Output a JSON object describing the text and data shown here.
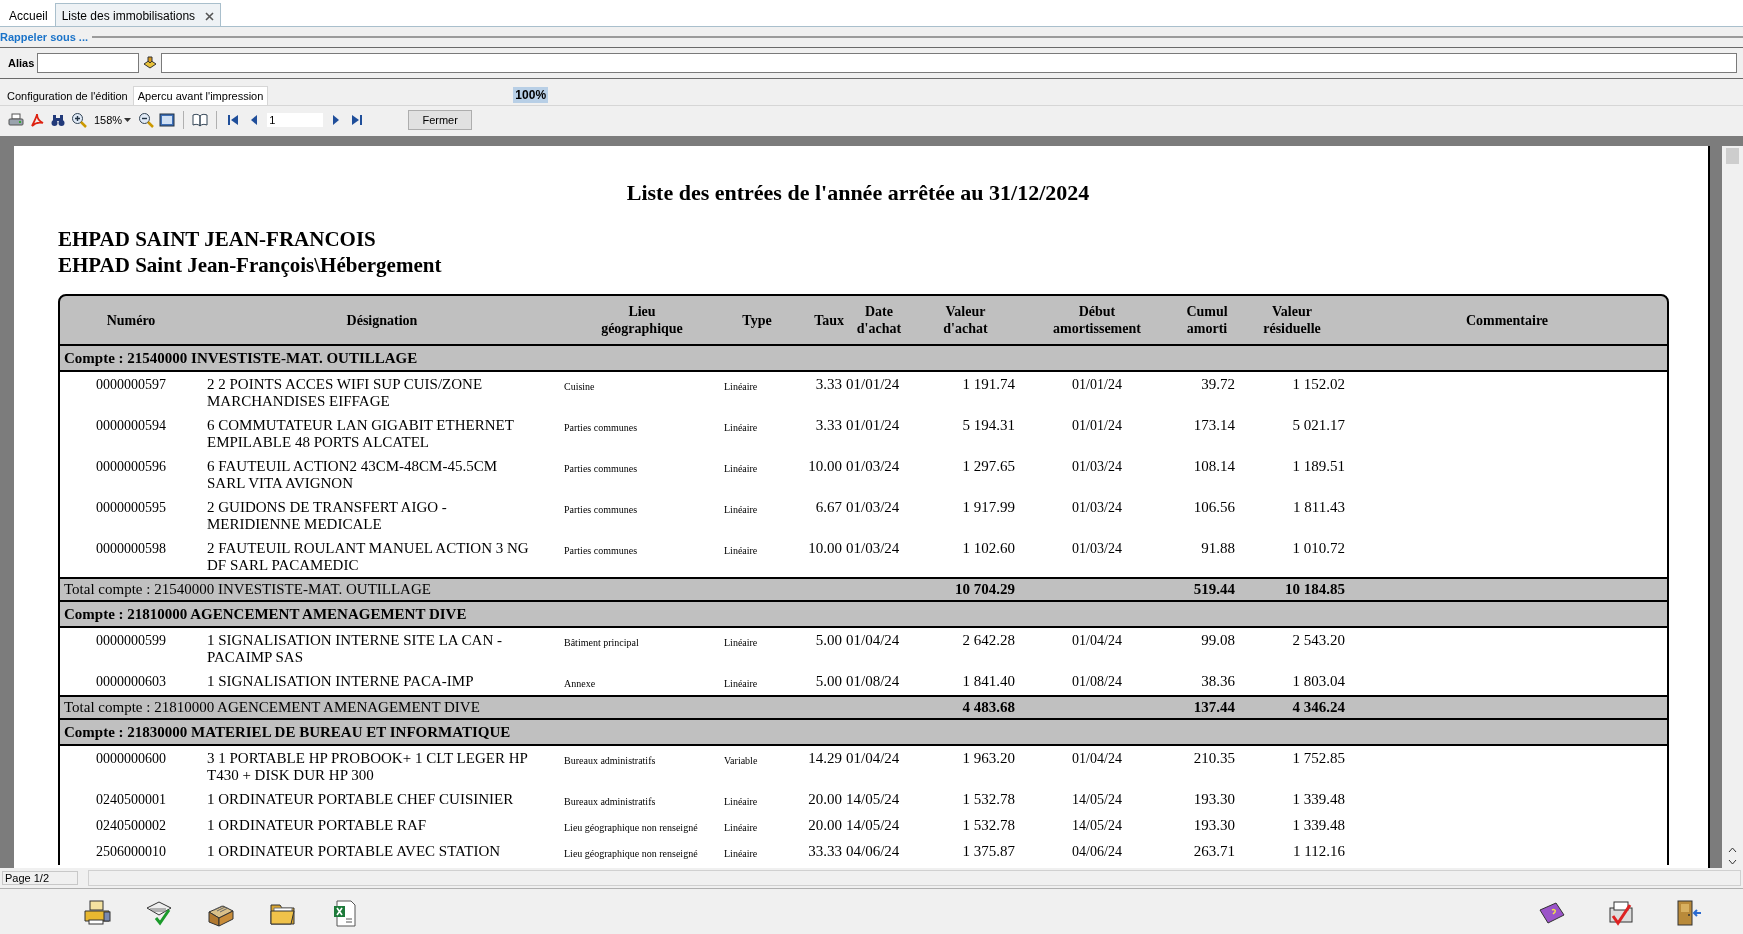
{
  "tabs": [
    {
      "label": "Accueil",
      "selected": false,
      "closable": false
    },
    {
      "label": "Liste des immobilisations",
      "selected": true,
      "closable": true
    }
  ],
  "recall_section": {
    "title": "Rappeler sous ..."
  },
  "alias": {
    "label": "Alias"
  },
  "subtabs": [
    {
      "label": "Configuration de l'édition",
      "selected": false
    },
    {
      "label": "Apercu avant l'impression",
      "selected": true
    }
  ],
  "progress_label": "100%",
  "toolbar": {
    "zoom": "158%",
    "page": "1",
    "close_button": "Fermer"
  },
  "report": {
    "title": "Liste des entrées de l'année arrêtée au 31/12/2024",
    "org_lines": [
      "EHPAD SAINT JEAN-FRANCOIS",
      "EHPAD Saint Jean-François\\Hébergement"
    ],
    "columns": [
      "Numéro",
      "Désignation",
      "Lieu géographique",
      "Type",
      "Taux",
      "Date d'achat",
      "Valeur d'achat",
      "Début amortissement",
      "Cumul amorti",
      "Valeur résiduelle",
      "Commentaire"
    ],
    "groups": [
      {
        "header": "Compte : 21540000  INVESTISTE-MAT. OUTILLAGE",
        "rows": [
          [
            "0000000597",
            "2 2 POINTS ACCES WIFI SUP CUIS/ZONE MARCHANDISES EIFFAGE",
            "Cuisine",
            "Linéaire",
            "3.33",
            "01/01/24",
            "1 191.74",
            "01/01/24",
            "39.72",
            "1 152.02"
          ],
          [
            "0000000594",
            "6 COMMUTATEUR LAN GIGABIT ETHERNET EMPILABLE 48 PORTS ALCATEL",
            "Parties communes",
            "Linéaire",
            "3.33",
            "01/01/24",
            "5 194.31",
            "01/01/24",
            "173.14",
            "5 021.17"
          ],
          [
            "0000000596",
            "6 FAUTEUIL ACTION2 43CM-48CM-45.5CM SARL VITA AVIGNON",
            "Parties communes",
            "Linéaire",
            "10.00",
            "01/03/24",
            "1 297.65",
            "01/03/24",
            "108.14",
            "1 189.51"
          ],
          [
            "0000000595",
            "2 GUIDONS DE TRANSFERT AIGO - MERIDIENNE MEDICALE",
            "Parties communes",
            "Linéaire",
            "6.67",
            "01/03/24",
            "1 917.99",
            "01/03/24",
            "106.56",
            "1 811.43"
          ],
          [
            "0000000598",
            "2 FAUTEUIL ROULANT MANUEL ACTION 3 NG DF SARL PACAMEDIC",
            "Parties communes",
            "Linéaire",
            "10.00",
            "01/03/24",
            "1 102.60",
            "01/03/24",
            "91.88",
            "1 010.72"
          ]
        ],
        "total": {
          "label": "Total compte : 21540000  INVESTISTE-MAT. OUTILLAGE",
          "valeur": "10 704.29",
          "cumul": "519.44",
          "residuelle": "10 184.85"
        }
      },
      {
        "header": "Compte : 21810000  AGENCEMENT AMENAGEMENT DIVE",
        "rows": [
          [
            "0000000599",
            "1 SIGNALISATION INTERNE SITE LA CAN - PACAIMP SAS",
            "Bâtiment principal",
            "Linéaire",
            "5.00",
            "01/04/24",
            "2 642.28",
            "01/04/24",
            "99.08",
            "2 543.20"
          ],
          [
            "0000000603",
            "1 SIGNALISATION INTERNE PACA-IMP",
            "Annexe",
            "Linéaire",
            "5.00",
            "01/08/24",
            "1 841.40",
            "01/08/24",
            "38.36",
            "1 803.04"
          ]
        ],
        "total": {
          "label": "Total compte : 21810000  AGENCEMENT AMENAGEMENT DIVE",
          "valeur": "4 483.68",
          "cumul": "137.44",
          "residuelle": "4 346.24"
        }
      },
      {
        "header": "Compte : 21830000  MATERIEL DE BUREAU ET INFORMATIQUE",
        "rows": [
          [
            "0000000600",
            "3 1 PORTABLE HP PROBOOK+ 1 CLT LEGER HP T430 + DISK DUR HP 300",
            "Bureaux administratifs",
            "Variable",
            "14.29",
            "01/04/24",
            "1 963.20",
            "01/04/24",
            "210.35",
            "1 752.85"
          ],
          [
            "0240500001",
            "1 ORDINATEUR PORTABLE CHEF CUISINIER",
            "Bureaux administratifs",
            "Linéaire",
            "20.00",
            "14/05/24",
            "1 532.78",
            "14/05/24",
            "193.30",
            "1 339.48"
          ],
          [
            "0240500002",
            "1 ORDINATEUR PORTABLE RAF",
            "Lieu géographique non renseigné",
            "Linéaire",
            "20.00",
            "14/05/24",
            "1 532.78",
            "14/05/24",
            "193.30",
            "1 339.48"
          ],
          [
            "2506000010",
            "1 ORDINATEUR PORTABLE AVEC STATION",
            "Lieu géographique non renseigné",
            "Linéaire",
            "33.33",
            "04/06/24",
            "1 375.87",
            "04/06/24",
            "263.71",
            "1 112.16"
          ]
        ]
      }
    ]
  },
  "status": "Page 1/2"
}
